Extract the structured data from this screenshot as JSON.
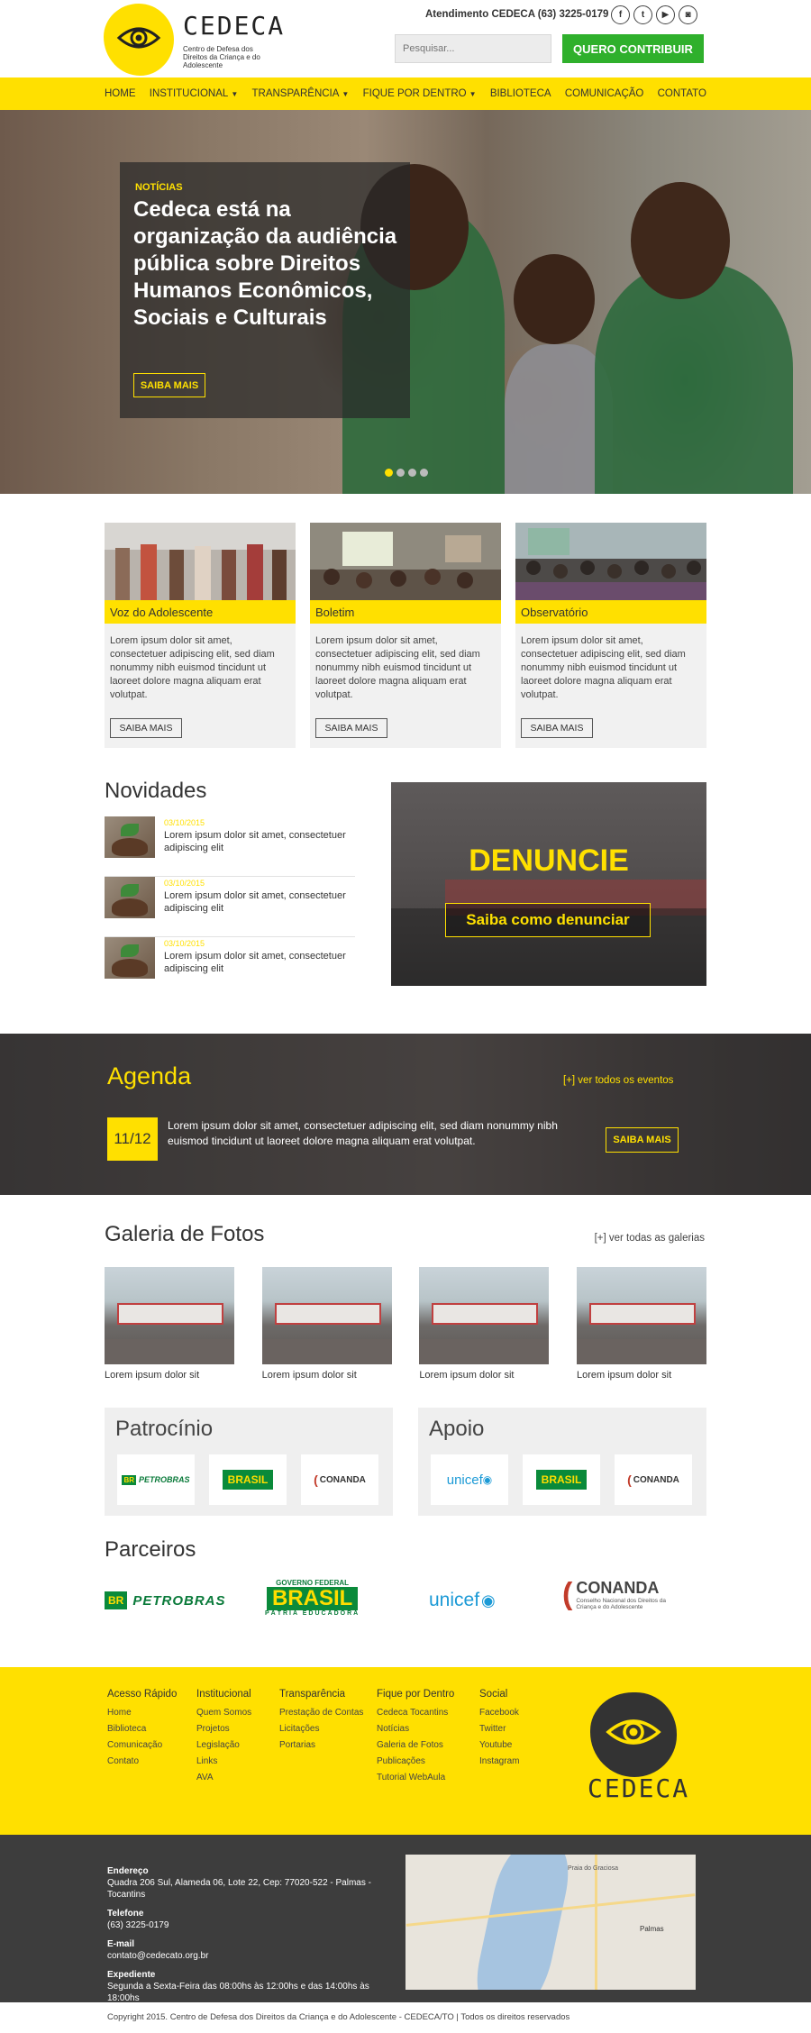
{
  "brand": {
    "name": "CEDECA",
    "subtitle": "Centro de Defesa dos Direitos da Criança e do Adolescente"
  },
  "header": {
    "phone": "Atendimento CEDECA (63) 3225-0179",
    "social": [
      "f",
      "t",
      "▶",
      "◙"
    ],
    "search_placeholder": "Pesquisar...",
    "contribute_label": "QUERO CONTRIBUIR"
  },
  "nav": {
    "items": [
      {
        "label": "HOME"
      },
      {
        "label": "INSTITUCIONAL",
        "dropdown": true
      },
      {
        "label": "TRANSPARÊNCIA",
        "dropdown": true
      },
      {
        "label": "FIQUE POR DENTRO",
        "dropdown": true
      },
      {
        "label": "BIBLIOTECA"
      },
      {
        "label": "COMUNICAÇÃO"
      },
      {
        "label": "CONTATO"
      }
    ]
  },
  "hero": {
    "kicker": "NOTÍCIAS",
    "title": "Cedeca está na organização da audiência pública sobre Direitos Humanos Econômicos, Sociais e Culturais",
    "button": "SAIBA MAIS",
    "slides": 4,
    "active_slide": 1
  },
  "cards": [
    {
      "title": "Voz do Adolescente",
      "text": "Lorem ipsum dolor sit amet, consectetuer adipiscing elit, sed diam nonummy nibh euismod tincidunt ut laoreet dolore magna aliquam erat volutpat.",
      "button": "SAIBA MAIS"
    },
    {
      "title": "Boletim",
      "text": "Lorem ipsum dolor sit amet, consectetuer adipiscing elit, sed diam nonummy nibh euismod tincidunt ut laoreet dolore magna aliquam erat volutpat.",
      "button": "SAIBA MAIS"
    },
    {
      "title": "Observatório",
      "text": "Lorem ipsum dolor sit amet, consectetuer adipiscing elit, sed diam nonummy nibh euismod tincidunt ut laoreet dolore magna aliquam erat volutpat.",
      "button": "SAIBA MAIS"
    }
  ],
  "novidades": {
    "title": "Novidades",
    "items": [
      {
        "date": "03/10/2015",
        "text": "Lorem ipsum dolor sit amet, consectetuer adipiscing elit"
      },
      {
        "date": "03/10/2015",
        "text": "Lorem ipsum dolor sit amet, consectetuer adipiscing elit"
      },
      {
        "date": "03/10/2015",
        "text": "Lorem ipsum dolor sit amet, consectetuer adipiscing elit"
      }
    ]
  },
  "denuncie": {
    "title": "DENUNCIE",
    "button": "Saiba como denunciar"
  },
  "agenda": {
    "title": "Agenda",
    "link": "[+] ver todos os eventos",
    "date": "11/12",
    "text": "Lorem ipsum dolor sit amet, consectetuer adipiscing elit, sed diam nonummy nibh euismod tincidunt ut laoreet dolore magna aliquam erat volutpat.",
    "button": "SAIBA MAIS"
  },
  "galeria": {
    "title": "Galeria de Fotos",
    "link": "[+] ver todas as galerias",
    "items": [
      {
        "caption": "Lorem ipsum dolor sit"
      },
      {
        "caption": "Lorem ipsum dolor sit"
      },
      {
        "caption": "Lorem ipsum dolor sit"
      },
      {
        "caption": "Lorem ipsum dolor sit"
      }
    ]
  },
  "patrocinio": {
    "title": "Patrocínio",
    "logos": [
      "PETROBRAS",
      "BRASIL",
      "CONANDA"
    ]
  },
  "apoio": {
    "title": "Apoio",
    "logos": [
      "unicef",
      "BRASIL",
      "CONANDA"
    ]
  },
  "parceiros": {
    "title": "Parceiros",
    "logos": [
      "PETROBRAS",
      "BRASIL",
      "unicef",
      "CONANDA"
    ],
    "govt_text": "GOVERNO FEDERAL",
    "patria_text": "PÁTRIA EDUCADORA",
    "conanda_sub": "Conselho Nacional dos Direitos da Criança e do Adolescente"
  },
  "footer": {
    "columns": [
      {
        "title": "Acesso Rápido",
        "links": [
          "Home",
          "Biblioteca",
          "Comunicação",
          "Contato"
        ]
      },
      {
        "title": "Institucional",
        "links": [
          "Quem Somos",
          "Projetos",
          "Legislação",
          "Links",
          "AVA"
        ]
      },
      {
        "title": "Transparência",
        "links": [
          "Prestação de Contas",
          "Licitações",
          "Portarias"
        ]
      },
      {
        "title": "Fique por Dentro",
        "links": [
          "Cedeca Tocantins",
          "Notícias",
          "Galeria de Fotos",
          "Publicações",
          "Tutorial WebAula"
        ]
      },
      {
        "title": "Social",
        "links": [
          "Facebook",
          "Twitter",
          "Youtube",
          "Instagram"
        ]
      }
    ],
    "address_label": "Endereço",
    "address": "Quadra 206 Sul, Alameda 06, Lote 22, Cep: 77020-522 - Palmas - Tocantins",
    "phone_label": "Telefone",
    "phone": "(63) 3225-0179",
    "email_label": "E-mail",
    "email": "contato@cedecato.org.br",
    "hours_label": "Expediente",
    "hours": "Segunda a Sexta-Feira das 08:00hs às 12:00hs e das 14:00hs às 18:00hs",
    "map_city": "Palmas",
    "map_place": "Praia do Graciosa",
    "copyright": "Copyright 2015. Centro de Defesa dos Direitos da Criança e do Adolescente - CEDECA/TO | Todos os direitos reservados"
  },
  "colors": {
    "brand_yellow": "#ffe000",
    "cta_green": "#2fb02c",
    "footer_dark": "#3d3d3d"
  }
}
